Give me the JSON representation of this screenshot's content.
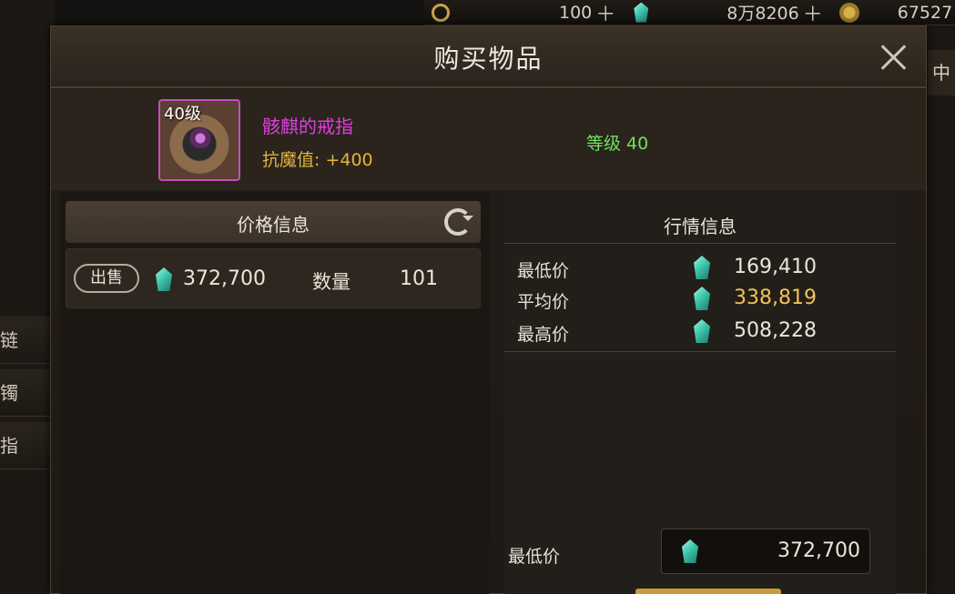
{
  "topbar": {
    "currency1_value": "100",
    "currency2_value": "8万8206",
    "currency3_value": "67527"
  },
  "background": {
    "left_tabs": [
      "链",
      "镯",
      "指"
    ],
    "right_tab": "中"
  },
  "dialog": {
    "title": "购买物品",
    "item": {
      "level_badge": "40级",
      "name": "骸麒的戒指",
      "stat": "抗魔值: +400",
      "requirement": "等级 40"
    },
    "price_panel": {
      "title": "价格信息",
      "offers": [
        {
          "badge": "出售",
          "price": "372,700",
          "qty_label": "数量",
          "qty": "101"
        }
      ]
    },
    "market_panel": {
      "title": "行情信息",
      "stats": [
        {
          "label": "最低价",
          "value": "169,410",
          "color": "#ece6da"
        },
        {
          "label": "平均价",
          "value": "338,819",
          "color": "#f2c15a"
        },
        {
          "label": "最高价",
          "value": "508,228",
          "color": "#ece6da"
        }
      ]
    },
    "min_price": {
      "label": "最低价",
      "value": "372,700"
    }
  },
  "icons": {
    "gem": "teal-gem-icon",
    "refresh": "refresh-icon",
    "close": "close-icon"
  }
}
